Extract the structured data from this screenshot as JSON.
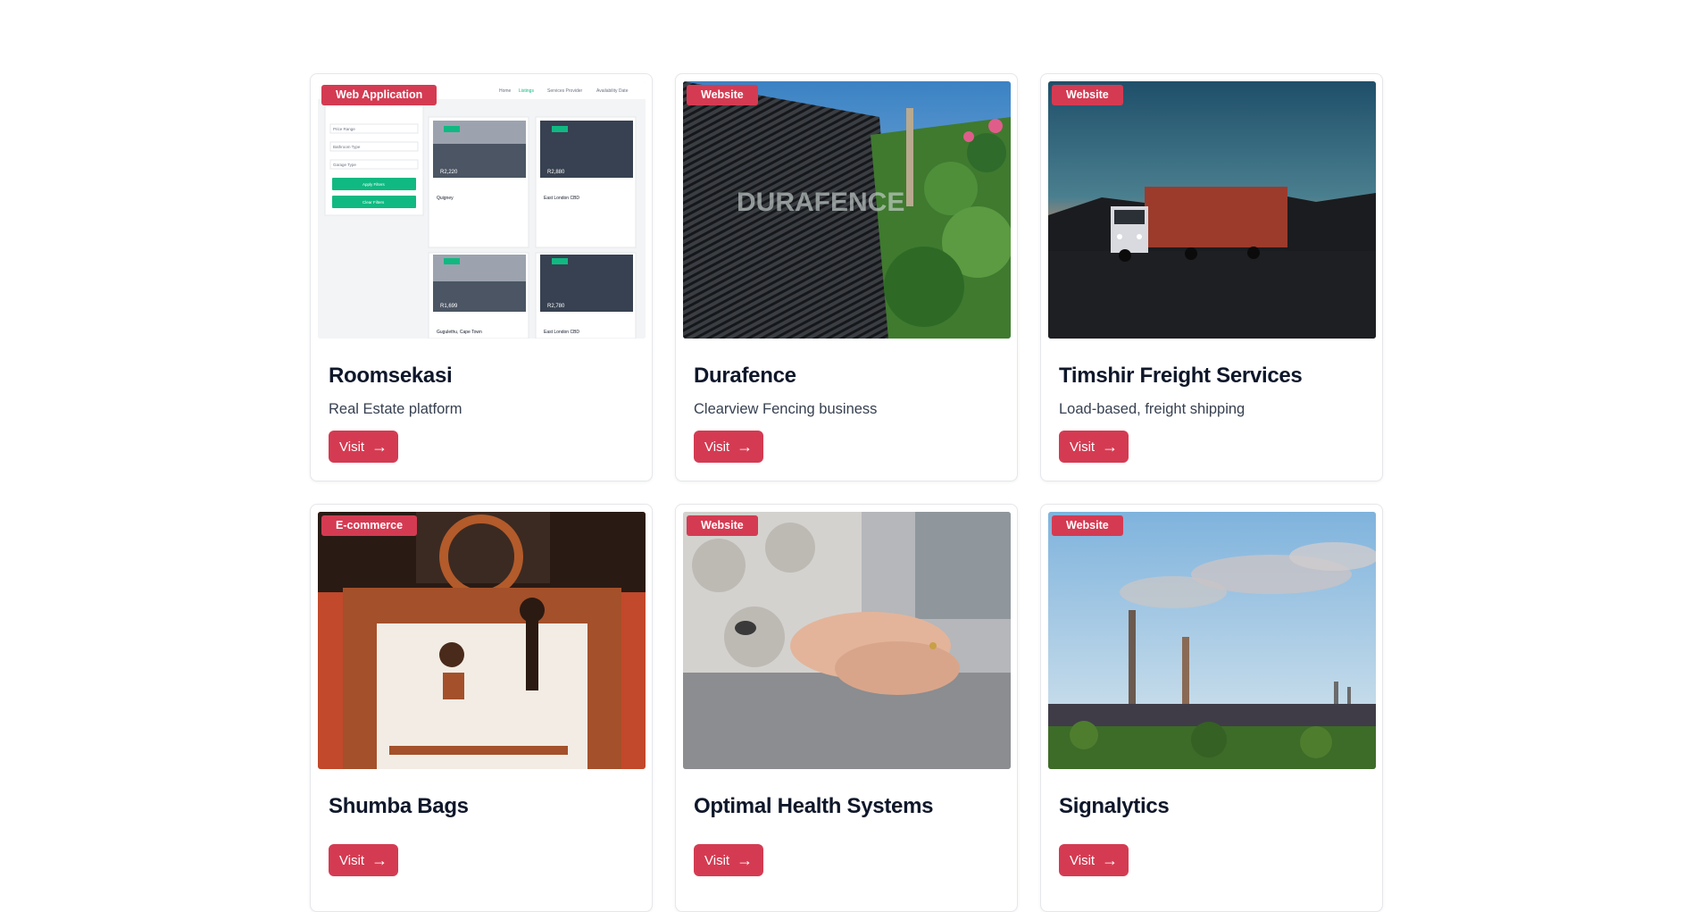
{
  "projects": [
    {
      "badge": "Web Application",
      "title": "Roomsekasi",
      "description": "Real Estate platform",
      "button": "Visit",
      "image": "real-estate-listing-screenshot",
      "thumbnail": {
        "nav": [
          "Home",
          "Listings",
          "Services Provider",
          "Availability Date"
        ],
        "filters": [
          "Property Type",
          "Price Range",
          "Bathroom Type",
          "Garage Type"
        ],
        "apply": "Apply Filters",
        "clear": "Clear Filters",
        "listings": [
          {
            "price": "R2,220",
            "tag": "New",
            "location": "Quigney"
          },
          {
            "price": "R2,880",
            "tag": "New",
            "location": "East London CBD"
          },
          {
            "price": "R1,699",
            "tag": "New",
            "location": "Gugulethu, Cape Town"
          },
          {
            "price": "R2,780",
            "tag": "New",
            "location": "East London CBD"
          }
        ]
      }
    },
    {
      "badge": "Website",
      "title": "Durafence",
      "description": "Clearview Fencing business",
      "button": "Visit",
      "image": "clearview-fence-photo",
      "thumbnail": {
        "logo": "DURAFENCE"
      }
    },
    {
      "badge": "Website",
      "title": "Timshir Freight Services",
      "description": "Load-based, freight shipping",
      "button": "Visit",
      "image": "freight-truck-night-photo"
    },
    {
      "badge": "E-commerce",
      "title": "Shumba Bags",
      "description": "",
      "button": "Visit",
      "image": "handbag-photo"
    },
    {
      "badge": "Website",
      "title": "Optimal Health Systems",
      "description": "",
      "button": "Visit",
      "image": "holding-hands-photo"
    },
    {
      "badge": "Website",
      "title": "Signalytics",
      "description": "",
      "button": "Visit",
      "image": "industrial-chimneys-photo"
    }
  ],
  "colors": {
    "accent": "#d43b52",
    "title": "#0f172a",
    "text": "#374151"
  }
}
